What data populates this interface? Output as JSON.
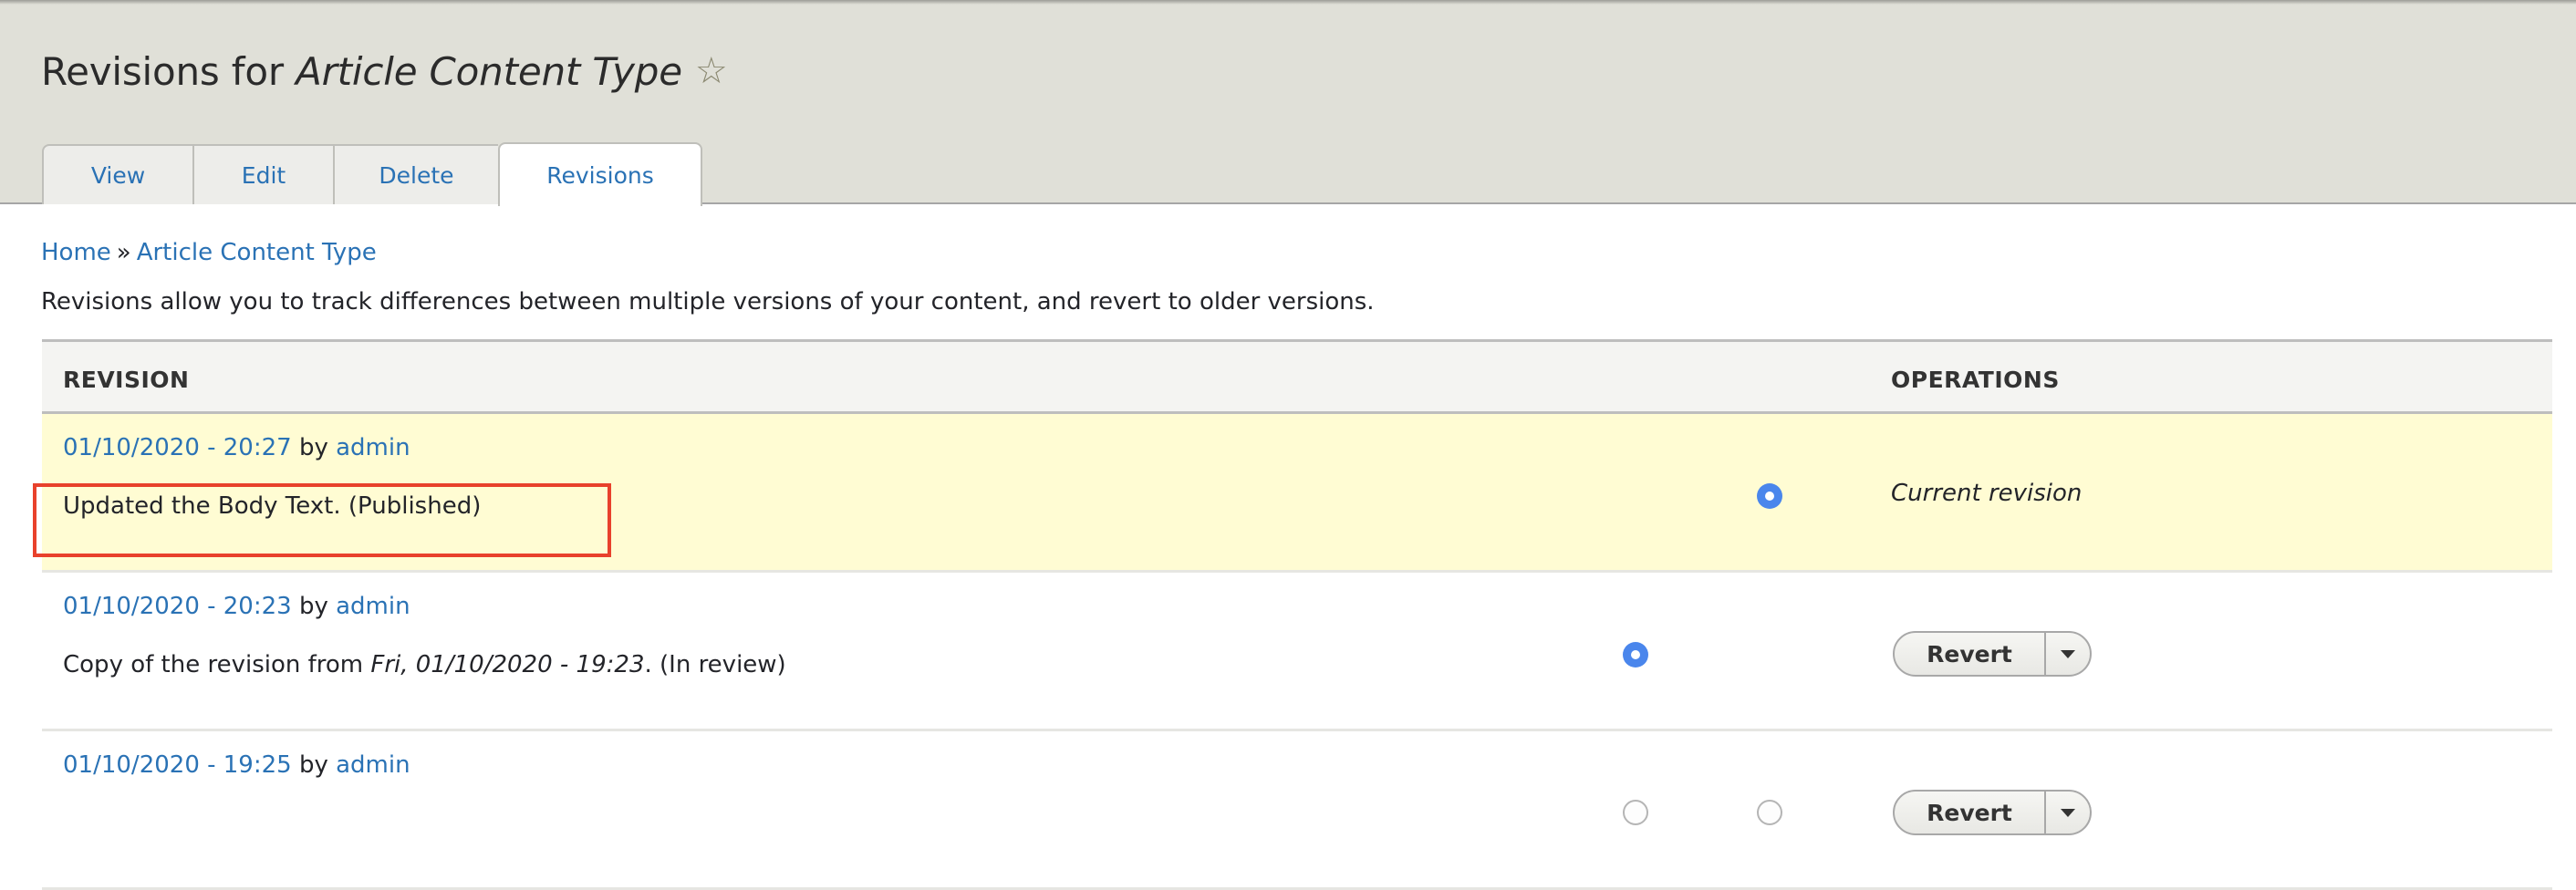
{
  "header": {
    "title_prefix": "Revisions for ",
    "title_entity": "Article Content Type",
    "star_icon": "☆",
    "tabs": [
      {
        "label": "View",
        "active": false
      },
      {
        "label": "Edit",
        "active": false
      },
      {
        "label": "Delete",
        "active": false
      },
      {
        "label": "Revisions",
        "active": true
      }
    ]
  },
  "breadcrumb": {
    "items": [
      "Home",
      "Article Content Type"
    ],
    "separator": "»"
  },
  "description": "Revisions allow you to track differences between multiple versions of your content, and revert to older versions.",
  "table": {
    "columns": [
      "REVISION",
      "OPERATIONS"
    ],
    "rows": [
      {
        "date": "01/10/2020 - 20:27",
        "by": "by",
        "author": "admin",
        "log": "Updated the Body Text. (Published)",
        "current": true,
        "radio_left_checked": null,
        "radio_right_checked": true,
        "operation": "Current revision"
      },
      {
        "date": "01/10/2020 - 20:23",
        "by": "by",
        "author": "admin",
        "log_prefix": "Copy of the revision from ",
        "log_italic": "Fri, 01/10/2020 - 19:23",
        "log_suffix": ". (In review)",
        "current": false,
        "radio_left_checked": true,
        "radio_right_checked": null,
        "operation": "Revert"
      },
      {
        "date": "01/10/2020 - 19:25",
        "by": "by",
        "author": "admin",
        "current": false,
        "radio_left_checked": false,
        "radio_right_checked": false,
        "operation": "Revert"
      }
    ]
  },
  "colors": {
    "link": "#2a72b5",
    "header_bg": "#e0e0d8",
    "current_row_bg": "#fffcd3",
    "radio_checked": "#4a86ec",
    "highlight_box": "#e8412c"
  }
}
